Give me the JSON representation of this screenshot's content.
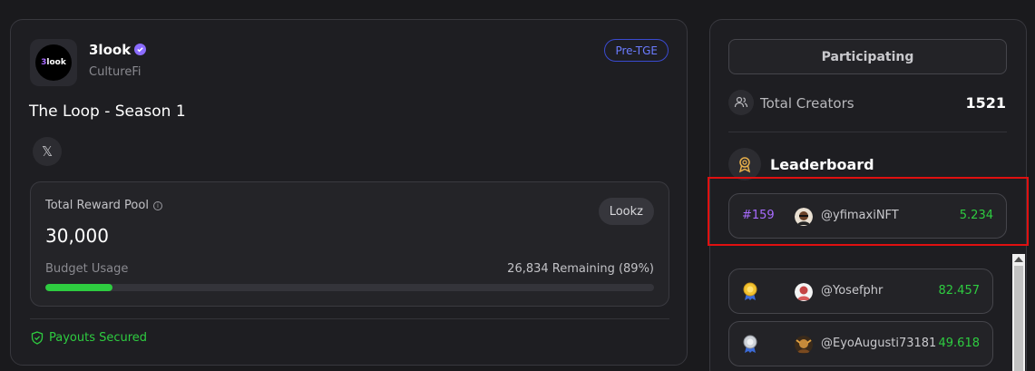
{
  "project": {
    "name": "3look",
    "category": "CultureFi",
    "badge": "Pre-TGE",
    "campaign_title": "The Loop - Season 1",
    "logo_text_a": "3",
    "logo_text_b": "look"
  },
  "social": {
    "x_label": "𝕏"
  },
  "reward": {
    "label": "Total Reward Pool",
    "token": "Lookz",
    "value": "30,000",
    "budget_label": "Budget Usage",
    "remaining": "26,834 Remaining (89%)",
    "progress_fraction": 0.11
  },
  "payouts": {
    "label": "Payouts Secured"
  },
  "sidebar": {
    "participating_label": "Participating",
    "creators_label": "Total Creators",
    "creators_value": "1521",
    "leaderboard_title": "Leaderboard"
  },
  "my_entry": {
    "rank": "#159",
    "handle": "@yfimaxiNFT",
    "score": "5.234"
  },
  "leaderboard": [
    {
      "handle": "@Yosefphr",
      "score": "82.457",
      "medal": "gold"
    },
    {
      "handle": "@EyoAugusti73181",
      "score": "49.618",
      "medal": "silver"
    }
  ],
  "colors": {
    "accent_green": "#2ecc40",
    "accent_purple": "#a86bff",
    "badge_blue": "#6b7cff",
    "highlight_red": "#e01010"
  }
}
